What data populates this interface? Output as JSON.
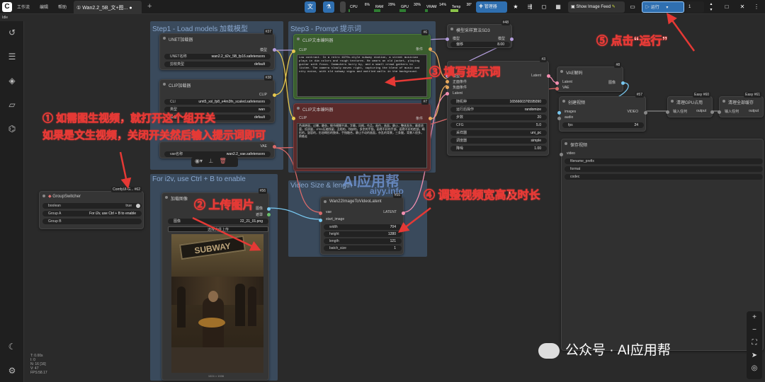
{
  "topbar": {
    "menu": [
      "工作流",
      "编辑",
      "帮助"
    ],
    "tab_label": "① Wan2.2_5B_文+图...",
    "meters": [
      {
        "label": "CPU",
        "pct": "6%",
        "level": 0.06
      },
      {
        "label": "RAM",
        "pct": "29%",
        "level": 0.29
      },
      {
        "label": "GPU",
        "pct": "30%",
        "level": 0.3
      },
      {
        "label": "VRAM",
        "pct": "14%",
        "level": 0.14
      },
      {
        "label": "Temp",
        "pct": "38°",
        "level": 0.38
      }
    ],
    "manager_label": "管理器",
    "show_feed_label": "Show Image Feed",
    "run_label": "运行",
    "run_count": "1",
    "status": "Idle"
  },
  "groups": {
    "step1": "Step1 - Load models  加载模型",
    "step3": "Step3 - Prompt  提示词",
    "i2v": "For i2v, use Ctrl + B to enable",
    "video_size": "Video Size & length"
  },
  "nodes": {
    "unet": {
      "title": "UNET加载器",
      "badge": "#37",
      "output": "模型",
      "w1_label": "UNET名称",
      "w1_value": "wan2.2_ti2v_5B_fp16.safetensors",
      "w2_label": "剪枝类型",
      "w2_value": "default"
    },
    "clip_loader": {
      "title": "CLIP加载器",
      "badge": "#38",
      "output": "CLIP",
      "w1_label": "CLI",
      "w1_value": "umt5_xxl_fp8_e4m3fn_scaled.safetensors",
      "w2_label": "类型",
      "w2_value": "wan",
      "w3_label": "设备",
      "w3_value": "default"
    },
    "vae_loader": {
      "output": "VAE",
      "w1_label": "vae名称",
      "w1_value": "wan2.2_vae.safetensors"
    },
    "clip_pos": {
      "title": "CLIP文本编码器",
      "badge": "#6",
      "input": "CLIP",
      "output": "条件",
      "text": "Low contrast. In a retro 1970s-style subway station, a street musician plays in dim colors and rough textures. He wears an old jacket, playing guitar with focus. Commuters hurry by, and a small crowd gathers to listen. The camera slowly moves right, capturing the blend of music and city noise, with old subway signs and mottled walls in the background."
    },
    "clip_neg": {
      "title": "CLIP文本编码器",
      "badge": "#7",
      "input": "CLIP",
      "output": "条件",
      "text": "色调艳丽，过曝，静态，细节模糊不清，字幕，风格，作品，画作，画面，静止，整体发灰，最差质量，低质量，JPEG压缩残留，丑陋的，残缺的，多余的手指，画得不好的手部，画得不好的脸部，畸形的，毁容的，形态畸形的肢体，手指融合，静止不动的画面，杂乱的背景，三条腿，背景人很多，倒着走"
    },
    "model_sampling": {
      "title": "模型采样算法SD3",
      "badge": "#48",
      "input": "模型",
      "output": "模型",
      "w1_label": "偏移",
      "w1_value": "8.00"
    },
    "ksampler": {
      "badge": "#3",
      "inputs": [
        "模型",
        "正面条件",
        "负面条件",
        "Latent"
      ],
      "output": "Latent",
      "widgets": [
        {
          "label": "随机种",
          "value": "1656660376595090"
        },
        {
          "label": "运行后操作",
          "value": "randomize"
        },
        {
          "label": "步数",
          "value": "20"
        },
        {
          "label": "CFG",
          "value": "5.0"
        },
        {
          "label": "采样器",
          "value": "uni_pc"
        },
        {
          "label": "调度器",
          "value": "simple"
        },
        {
          "label": "降噪",
          "value": "1.00"
        }
      ]
    },
    "vae_decode": {
      "title": "VAE解码",
      "badge": "#8",
      "inputs": [
        "Latent",
        "VAE"
      ],
      "output": "图像"
    },
    "create_video": {
      "title": "创建视频",
      "badge": "#57",
      "inputs": [
        "images",
        "audio"
      ],
      "output": "VIDEO",
      "w1_label": "fps",
      "w1_value": "24"
    },
    "clear_gpu": {
      "title": "清理GPU占用",
      "badge": "Easy #60",
      "input": "输入任何",
      "output": "output"
    },
    "clear_all": {
      "title": "清理全部缓存",
      "badge": "Easy #61",
      "input": "输入任何",
      "output": "output"
    },
    "save_video": {
      "title": "保存视频",
      "input": "video",
      "widgets": [
        "filename_prefix",
        "format",
        "codec"
      ]
    },
    "group_switcher": {
      "title": "GroupSwitcher",
      "badge": "ComfyUI-G... #62",
      "w0_label": "boolean",
      "w0_value": "true",
      "w1_label": "Group A",
      "w1_value": "For i2v, use Ctrl + B to enable",
      "w2_label": "Group B",
      "w2_value": ""
    },
    "load_image": {
      "title": "加载图像",
      "badge": "#56",
      "outputs": [
        "图像",
        "遮罩"
      ],
      "w1_label": "图像",
      "w1_value": "22_21_01.png",
      "upload_label": "选择文件上传",
      "img_size": "1024 × 1536",
      "sign": "SUBWAY"
    },
    "wan_latent": {
      "title": "Wan22ImageToVideoLatent",
      "badge": "#55",
      "inputs": [
        "vae",
        "start_image"
      ],
      "output": "LATENT",
      "widgets": [
        {
          "label": "width",
          "value": "704"
        },
        {
          "label": "height",
          "value": "1280"
        },
        {
          "label": "length",
          "value": "121"
        },
        {
          "label": "batch_size",
          "value": "1"
        }
      ]
    }
  },
  "annotations": {
    "a1_line1": "① 如需图生视频，就打开这个组开关",
    "a1_line2": "如果是文生视频，关闭开关然后输入提示词即可",
    "a2": "② 上传图片",
    "a3": "③ 填写提示词",
    "a4": "④ 调整视频宽高及时长",
    "a5": "⑤ 点击“运行”"
  },
  "watermark": {
    "line1": "AI应用帮",
    "line2": "aiyy.info"
  },
  "corner_stats": [
    "T: 0.00s",
    "I: 0",
    "N: 16 [16]",
    "V: 47",
    "FPS:58.17"
  ],
  "footer_wechat": "公众号 · AI应用帮",
  "colors": {
    "accent": "#2f6fb0",
    "annotation": "#e53935",
    "positive_group": "#3b5e2e",
    "negative_group": "#5a2a2a"
  }
}
